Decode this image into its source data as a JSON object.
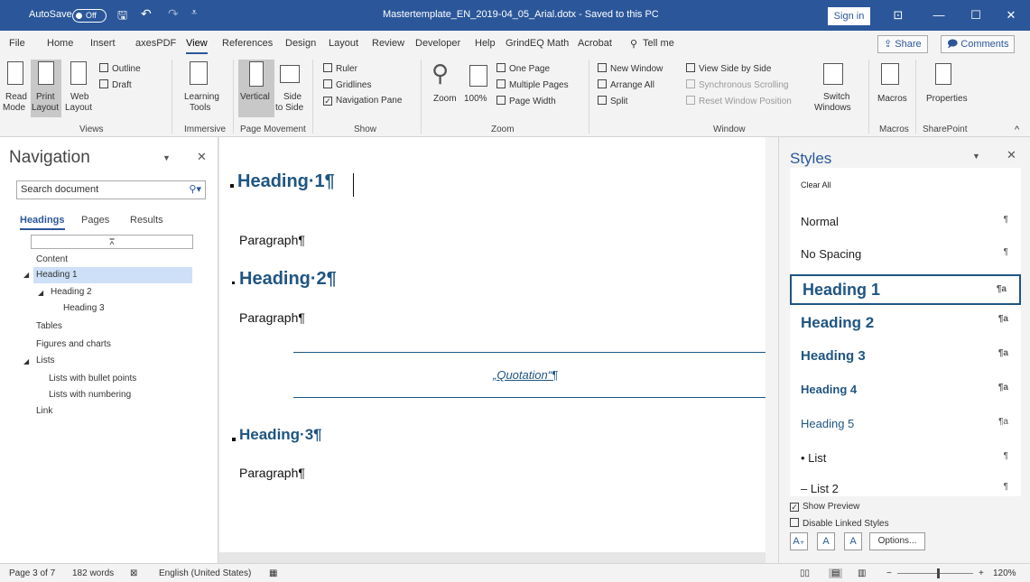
{
  "titlebar": {
    "autosave_label": "AutoSave",
    "autosave_state": "Off",
    "doc_title": "Mastertemplate_EN_2019-04_05_Arial.dotx  -  Saved to this PC",
    "signin": "Sign in"
  },
  "menu": {
    "items": [
      "File",
      "Home",
      "Insert",
      "axesPDF",
      "View",
      "References",
      "Design",
      "Layout",
      "Review",
      "Developer",
      "Help",
      "GrindEQ Math",
      "Acrobat"
    ],
    "active": "View",
    "tellme": "Tell me",
    "share": "Share",
    "comments": "Comments"
  },
  "ribbon": {
    "views": {
      "read_mode_1": "Read",
      "read_mode_2": "Mode",
      "print_layout_1": "Print",
      "print_layout_2": "Layout",
      "web_layout_1": "Web",
      "web_layout_2": "Layout",
      "outline": "Outline",
      "draft": "Draft",
      "group": "Views"
    },
    "immersive": {
      "learning_tools_1": "Learning",
      "learning_tools_2": "Tools",
      "group": "Immersive"
    },
    "page_movement": {
      "vertical": "Vertical",
      "side_1": "Side",
      "side_2": "to Side",
      "group": "Page Movement"
    },
    "show": {
      "ruler": "Ruler",
      "gridlines": "Gridlines",
      "nav_pane": "Navigation Pane",
      "group": "Show"
    },
    "zoom": {
      "zoom": "Zoom",
      "hundred": "100%",
      "one_page": "One Page",
      "multiple_pages": "Multiple Pages",
      "page_width": "Page Width",
      "group": "Zoom"
    },
    "window": {
      "new_window": "New Window",
      "arrange_all": "Arrange All",
      "split": "Split",
      "side_by_side": "View Side by Side",
      "sync_scroll": "Synchronous Scrolling",
      "reset_pos": "Reset Window Position",
      "switch_1": "Switch",
      "switch_2": "Windows",
      "group": "Window"
    },
    "macros": {
      "label": "Macros",
      "group": "Macros"
    },
    "sharepoint": {
      "label": "Properties",
      "group": "SharePoint"
    }
  },
  "navigation": {
    "title": "Navigation",
    "search_placeholder": "Search document",
    "tabs": [
      "Headings",
      "Pages",
      "Results"
    ],
    "items": [
      "Content",
      "Heading 1",
      "Heading 2",
      "Heading 3",
      "Tables",
      "Figures and charts",
      "Lists",
      "Lists with bullet points",
      "Lists with numbering",
      "Link"
    ]
  },
  "document": {
    "h1": "Heading·1¶",
    "p1": "Paragraph¶",
    "h2": "Heading·2¶",
    "p2": "Paragraph¶",
    "quote": "„Quotation“¶",
    "h3": "Heading·3¶",
    "p3": "Paragraph¶"
  },
  "styles": {
    "title": "Styles",
    "items": [
      {
        "name": "Clear All",
        "mark": ""
      },
      {
        "name": "Normal",
        "mark": "¶"
      },
      {
        "name": "No Spacing",
        "mark": "¶"
      },
      {
        "name": "Heading 1",
        "mark": "¶a"
      },
      {
        "name": "Heading 2",
        "mark": "¶a"
      },
      {
        "name": "Heading 3",
        "mark": "¶a"
      },
      {
        "name": "Heading 4",
        "mark": "¶a"
      },
      {
        "name": "Heading 5",
        "mark": "¶a"
      },
      {
        "name": "• List",
        "mark": "¶"
      },
      {
        "name": "– List 2",
        "mark": "¶"
      }
    ],
    "selected": "Heading 1",
    "show_preview": "Show Preview",
    "disable_linked": "Disable Linked Styles",
    "options": "Options..."
  },
  "status": {
    "page": "Page 3 of 7",
    "words": "182 words",
    "language": "English (United States)",
    "zoom": "120%",
    "zoom_level": 1.2
  }
}
